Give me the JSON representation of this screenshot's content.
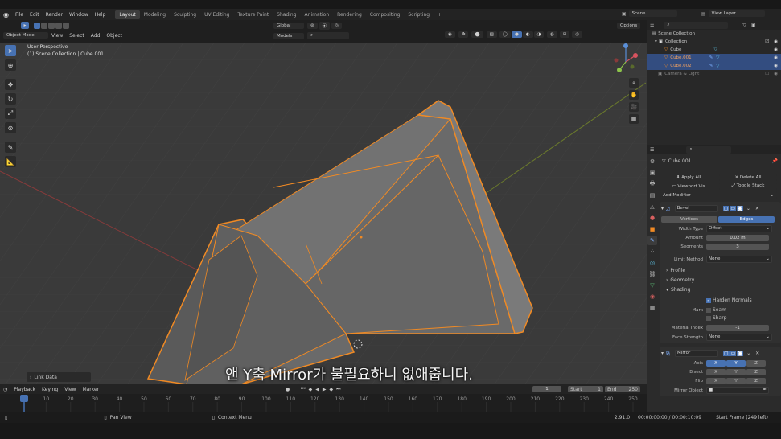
{
  "menubar": {
    "items": [
      "File",
      "Edit",
      "Render",
      "Window",
      "Help"
    ],
    "workspaces": [
      "Layout",
      "Modeling",
      "Sculpting",
      "UV Editing",
      "Texture Paint",
      "Shading",
      "Animation",
      "Rendering",
      "Compositing",
      "Scripting"
    ],
    "scene_label": "Scene",
    "view_layer_label": "View Layer"
  },
  "viewport_header": {
    "mode": "Object Mode",
    "menus": [
      "View",
      "Select",
      "Add",
      "Object"
    ],
    "orientation": "Global",
    "models_label": "Models",
    "options_label": "Options"
  },
  "viewport": {
    "perspective": "User Perspective",
    "collection_path": "(1) Scene Collection | Cube.001",
    "link_data": "Link Data"
  },
  "subtitle": "앤 Y축 Mirror가 불필요하니 없애줍니다.",
  "outliner": {
    "items": [
      {
        "label": "Scene Collection",
        "selected": false
      },
      {
        "label": "Collection",
        "selected": false
      },
      {
        "label": "Cube",
        "selected": false
      },
      {
        "label": "Cube.001",
        "selected": true
      },
      {
        "label": "Cube.002",
        "selected": true
      },
      {
        "label": "Camera & Light",
        "selected": false
      }
    ]
  },
  "properties": {
    "object_name": "Cube.001",
    "apply_all": "Apply All",
    "delete_all": "Delete All",
    "viewport_vis": "Viewport Vis",
    "toggle_stack": "Toggle Stack",
    "add_modifier": "Add Modifier",
    "bevel": {
      "name": "Bevel",
      "tab_vertices": "Vertices",
      "tab_edges": "Edges",
      "width_type_label": "Width Type",
      "width_type_value": "Offset",
      "amount_label": "Amount",
      "amount_value": "0.02 m",
      "segments_label": "Segments",
      "segments_value": "3",
      "limit_method_label": "Limit Method",
      "limit_method_value": "None",
      "profile": "Profile",
      "geometry": "Geometry",
      "shading": "Shading",
      "harden_normals": "Harden Normals",
      "mark_label": "Mark",
      "seam": "Seam",
      "sharp": "Sharp",
      "material_index_label": "Material Index",
      "material_index_value": "-1",
      "face_strength_label": "Face Strength",
      "face_strength_value": "None"
    },
    "mirror": {
      "name": "Mirror",
      "axis_label": "Axis",
      "bisect_label": "Bisect",
      "flip_label": "Flip",
      "x": "X",
      "y": "Y",
      "z": "Z",
      "mirror_object_label": "Mirror Object"
    }
  },
  "timeline": {
    "menus": [
      "Playback",
      "Keying",
      "View",
      "Marker"
    ],
    "current_frame": "1",
    "start_label": "Start",
    "start_value": "1",
    "end_label": "End",
    "end_value": "250",
    "ticks": [
      "1",
      "10",
      "20",
      "30",
      "40",
      "50",
      "60",
      "70",
      "80",
      "90",
      "100",
      "110",
      "120",
      "130",
      "140",
      "150",
      "160",
      "170",
      "180",
      "190",
      "200",
      "210",
      "220",
      "230",
      "240",
      "250"
    ]
  },
  "status": {
    "pan_view": "Pan View",
    "context_menu": "Context Menu",
    "version": "2.91.0",
    "timecode": "00:00:00:00 / 00:00:10:09",
    "start_frame": "Start Frame (249 left)"
  },
  "colors": {
    "accent": "#4772b3",
    "selection_orange": "#f08a24",
    "viewport_bg": "#3a3a3a"
  }
}
